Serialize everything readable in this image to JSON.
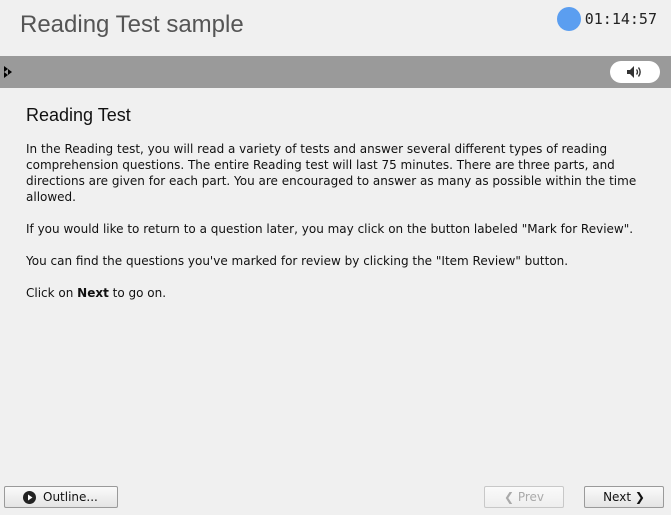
{
  "header": {
    "title": "Reading Test sample",
    "timer": "01:14:57"
  },
  "colors": {
    "timer_dot": "#5b9ef0",
    "toolbar": "#9a9a9a",
    "background": "#f0f0f0"
  },
  "toolbar": {
    "collapse_icon": "double-chevron-right-icon",
    "volume_icon": "speaker-icon"
  },
  "content": {
    "title": "Reading Test",
    "paragraph1": "In the Reading test, you will read a variety of tests and answer several different types of reading comprehension questions. The entire Reading test will last 75 minutes. There are three parts, and directions are given for each part. You are encouraged to answer as many as possible within the time allowed.",
    "paragraph2": "If you would like to return to a question later, you may click on the button labeled \"Mark for Review\".",
    "paragraph3": "You can find the questions you've marked for review by clicking the \"Item Review\" button.",
    "paragraph4_prefix": "Click on ",
    "paragraph4_bold": "Next",
    "paragraph4_suffix": " to go on."
  },
  "footer": {
    "outline_label": "Outline...",
    "prev_label": "Prev",
    "next_label": "Next",
    "prev_chevron": "❮",
    "next_chevron": "❯"
  }
}
